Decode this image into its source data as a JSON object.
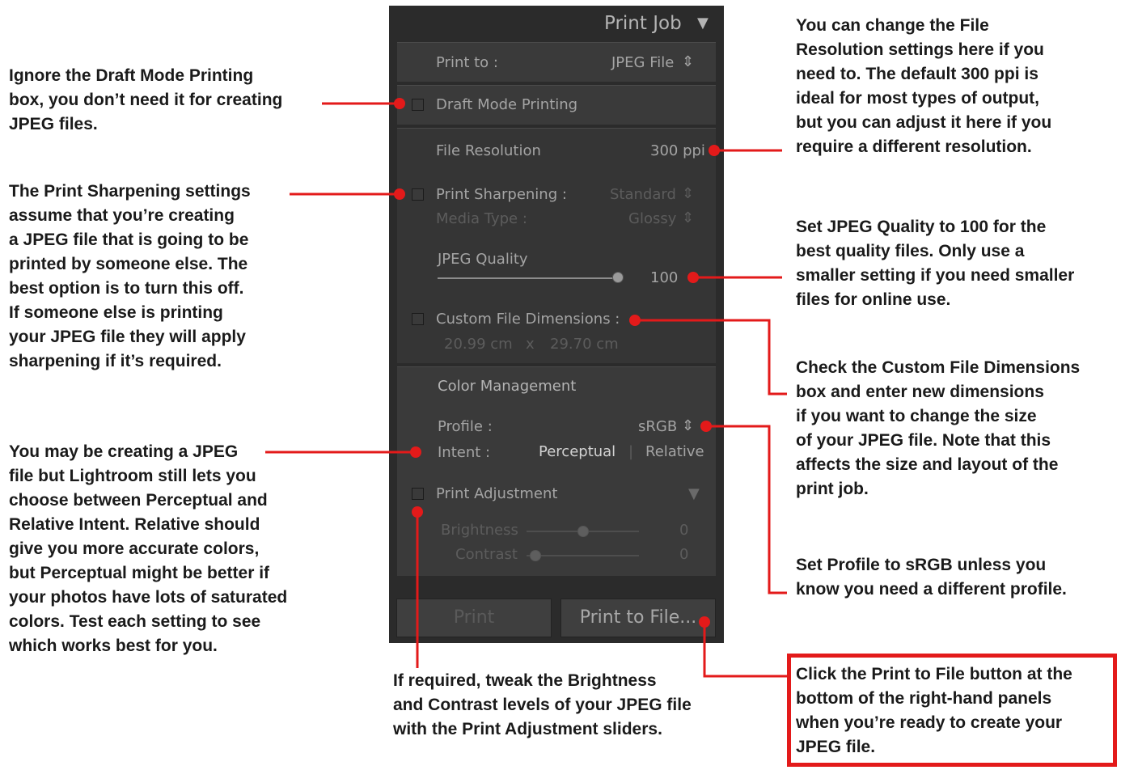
{
  "panel": {
    "title": "Print Job",
    "print_to_label": "Print to :",
    "print_to_value": "JPEG File",
    "draft_mode": "Draft Mode Printing",
    "file_resolution_label": "File Resolution",
    "file_resolution_value": "300 ppi",
    "print_sharpening_label": "Print Sharpening :",
    "print_sharpening_value": "Standard",
    "media_type_label": "Media Type :",
    "media_type_value": "Glossy",
    "jpeg_quality_label": "JPEG Quality",
    "jpeg_quality_value": "100",
    "custom_dims_label": "Custom File Dimensions :",
    "dim_width": "20.99 cm",
    "dim_x": "x",
    "dim_height": "29.70 cm",
    "color_mgmt": "Color Management",
    "profile_label": "Profile :",
    "profile_value": "sRGB",
    "intent_label": "Intent :",
    "intent_perceptual": "Perceptual",
    "intent_sep": "|",
    "intent_relative": "Relative",
    "print_adjustment": "Print Adjustment",
    "brightness_label": "Brightness",
    "brightness_value": "0",
    "contrast_label": "Contrast",
    "contrast_value": "0",
    "print_button": "Print",
    "print_to_file_button": "Print to File..."
  },
  "notes": {
    "draft": "Ignore the Draft Mode Printing\nbox, you don’t need it for creating\nJPEG files.",
    "sharpening": "The Print Sharpening settings\nassume that you’re creating\na JPEG file that is going to be\nprinted by someone else. The\nbest option is to turn this off.\nIf someone else is printing\nyour JPEG file they will apply\nsharpening if it’s required.",
    "intent": "You may be creating a JPEG\nfile but Lightroom still lets you\nchoose between Perceptual and\nRelative Intent. Relative should\ngive you more accurate colors,\nbut Perceptual might be better if\nyour photos have lots of saturated\ncolors. Test each setting to see\nwhich works best for you.",
    "brightness": "If required, tweak the Brightness\nand Contrast levels of your JPEG file\nwith the Print Adjustment sliders.",
    "resolution": "You can change the File\nResolution settings here if you\nneed to. The default 300 ppi is\nideal for most types of output,\nbut you can adjust it here if you\nrequire a different resolution.",
    "quality": "Set JPEG Quality to 100 for the\nbest quality files. Only use a\nsmaller setting if you need smaller\nfiles for online use.",
    "dimensions": "Check the Custom File Dimensions\nbox and enter new dimensions\nif you want to change the size\nof your JPEG file. Note that this\naffects the size and layout of the\nprint job.",
    "profile": "Set Profile to sRGB unless you\nknow you need a different profile.",
    "print_to_file": "Click the Print to File button at the\nbottom of the right-hand panels\nwhen you’re ready to create your\nJPEG file."
  },
  "colors": {
    "accent": "#e31a1a",
    "panel": "#2b2b2b",
    "section": "#3a3a3a",
    "text": "#a4a4a4"
  }
}
